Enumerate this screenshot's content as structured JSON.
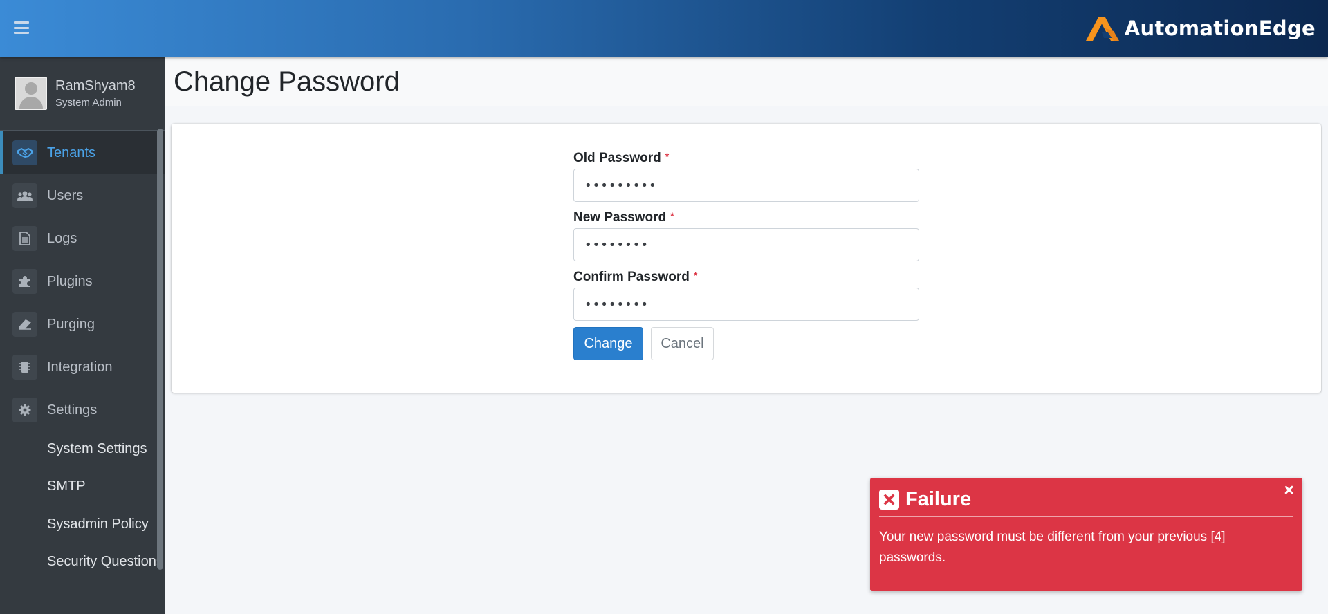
{
  "topbar": {
    "menu_icon": "hamburger-icon",
    "brand_name": "AutomationEdge",
    "brand_color": "#f7941d"
  },
  "user": {
    "name": "RamShyam8",
    "role": "System Admin"
  },
  "sidebar": {
    "items": [
      {
        "label": "Tenants",
        "icon": "handshake-icon",
        "active": true
      },
      {
        "label": "Users",
        "icon": "users-icon",
        "active": false
      },
      {
        "label": "Logs",
        "icon": "document-icon",
        "active": false
      },
      {
        "label": "Plugins",
        "icon": "puzzle-icon",
        "active": false
      },
      {
        "label": "Purging",
        "icon": "eraser-icon",
        "active": false
      },
      {
        "label": "Integration",
        "icon": "chip-icon",
        "active": false
      },
      {
        "label": "Settings",
        "icon": "gear-icon",
        "active": false
      }
    ],
    "sub_items": [
      {
        "label": "System Settings"
      },
      {
        "label": "SMTP"
      },
      {
        "label": "Sysadmin Policy"
      },
      {
        "label": "Security Questions"
      }
    ]
  },
  "page": {
    "title": "Change Password"
  },
  "form": {
    "old_password": {
      "label": "Old Password",
      "required": "*",
      "value": "•••••••••"
    },
    "new_password": {
      "label": "New Password",
      "required": "*",
      "value": "••••••••"
    },
    "confirm_password": {
      "label": "Confirm Password",
      "required": "*",
      "value": "••••••••"
    },
    "change_label": "Change",
    "cancel_label": "Cancel"
  },
  "toast": {
    "title": "Failure",
    "close": "×",
    "message": "Your new password must be different from your previous [4] passwords.",
    "color": "#dc3545"
  },
  "colors": {
    "accent": "#2a7fce",
    "active_nav": "#4ba3e8",
    "sidebar_bg": "#343a40"
  }
}
